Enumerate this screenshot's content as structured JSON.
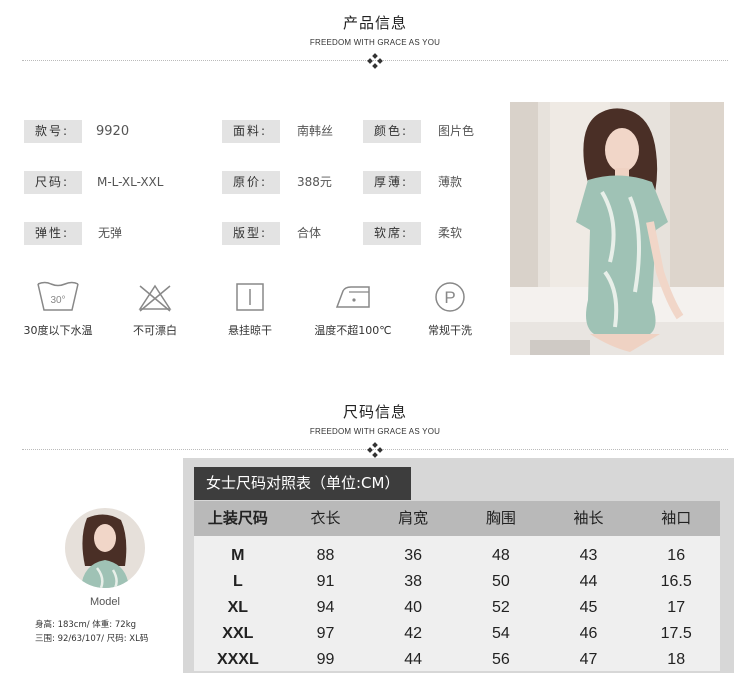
{
  "section_product": {
    "title": "产品信息",
    "subtitle": "FREEDOM WITH GRACE AS YOU"
  },
  "section_size": {
    "title": "尺码信息",
    "subtitle": "FREEDOM WITH GRACE AS YOU"
  },
  "attributes": [
    {
      "label": "款号:",
      "value": "9920"
    },
    {
      "label": "面料:",
      "value": "南韩丝"
    },
    {
      "label": "颜色:",
      "value": "图片色"
    },
    {
      "label": "尺码:",
      "value": "M-L-XL-XXL"
    },
    {
      "label": "原价:",
      "value": "388元"
    },
    {
      "label": "厚薄:",
      "value": "薄款"
    },
    {
      "label": "弹性:",
      "value": "无弹"
    },
    {
      "label": "版型:",
      "value": "合体"
    },
    {
      "label": "软席:",
      "value": "柔软"
    }
  ],
  "care": [
    {
      "icon": "wash-30-icon",
      "label": "30度以下水温",
      "icon_text": "30°"
    },
    {
      "icon": "no-bleach-icon",
      "label": "不可漂白"
    },
    {
      "icon": "hang-dry-icon",
      "label": "悬挂晾干"
    },
    {
      "icon": "iron-icon",
      "label": "温度不超100℃"
    },
    {
      "icon": "dry-clean-icon",
      "label": "常规干洗",
      "icon_text": "P"
    }
  ],
  "size_table": {
    "title": "女士尺码对照表（单位:CM）",
    "headers": [
      "上装尺码",
      "衣长",
      "肩宽",
      "胸围",
      "袖长",
      "袖口"
    ],
    "rows": [
      [
        "M",
        "88",
        "36",
        "48",
        "43",
        "16"
      ],
      [
        "L",
        "91",
        "38",
        "50",
        "44",
        "16.5"
      ],
      [
        "XL",
        "94",
        "40",
        "52",
        "45",
        "17"
      ],
      [
        "XXL",
        "97",
        "42",
        "54",
        "46",
        "17.5"
      ],
      [
        "XXXL",
        "99",
        "44",
        "56",
        "47",
        "18"
      ]
    ]
  },
  "model": {
    "name": "Model",
    "stat1": "身高: 183cm/ 体重: 72kg",
    "stat2": "三围: 92/63/107/ 尺码: XL码"
  },
  "colors": {
    "label_bg": "#e3e3e3",
    "table_title_bg": "#3d3d3d",
    "table_head_bg": "#b9b9b9",
    "table_body_bg": "#efefef",
    "dress": "#9fc2b5"
  }
}
